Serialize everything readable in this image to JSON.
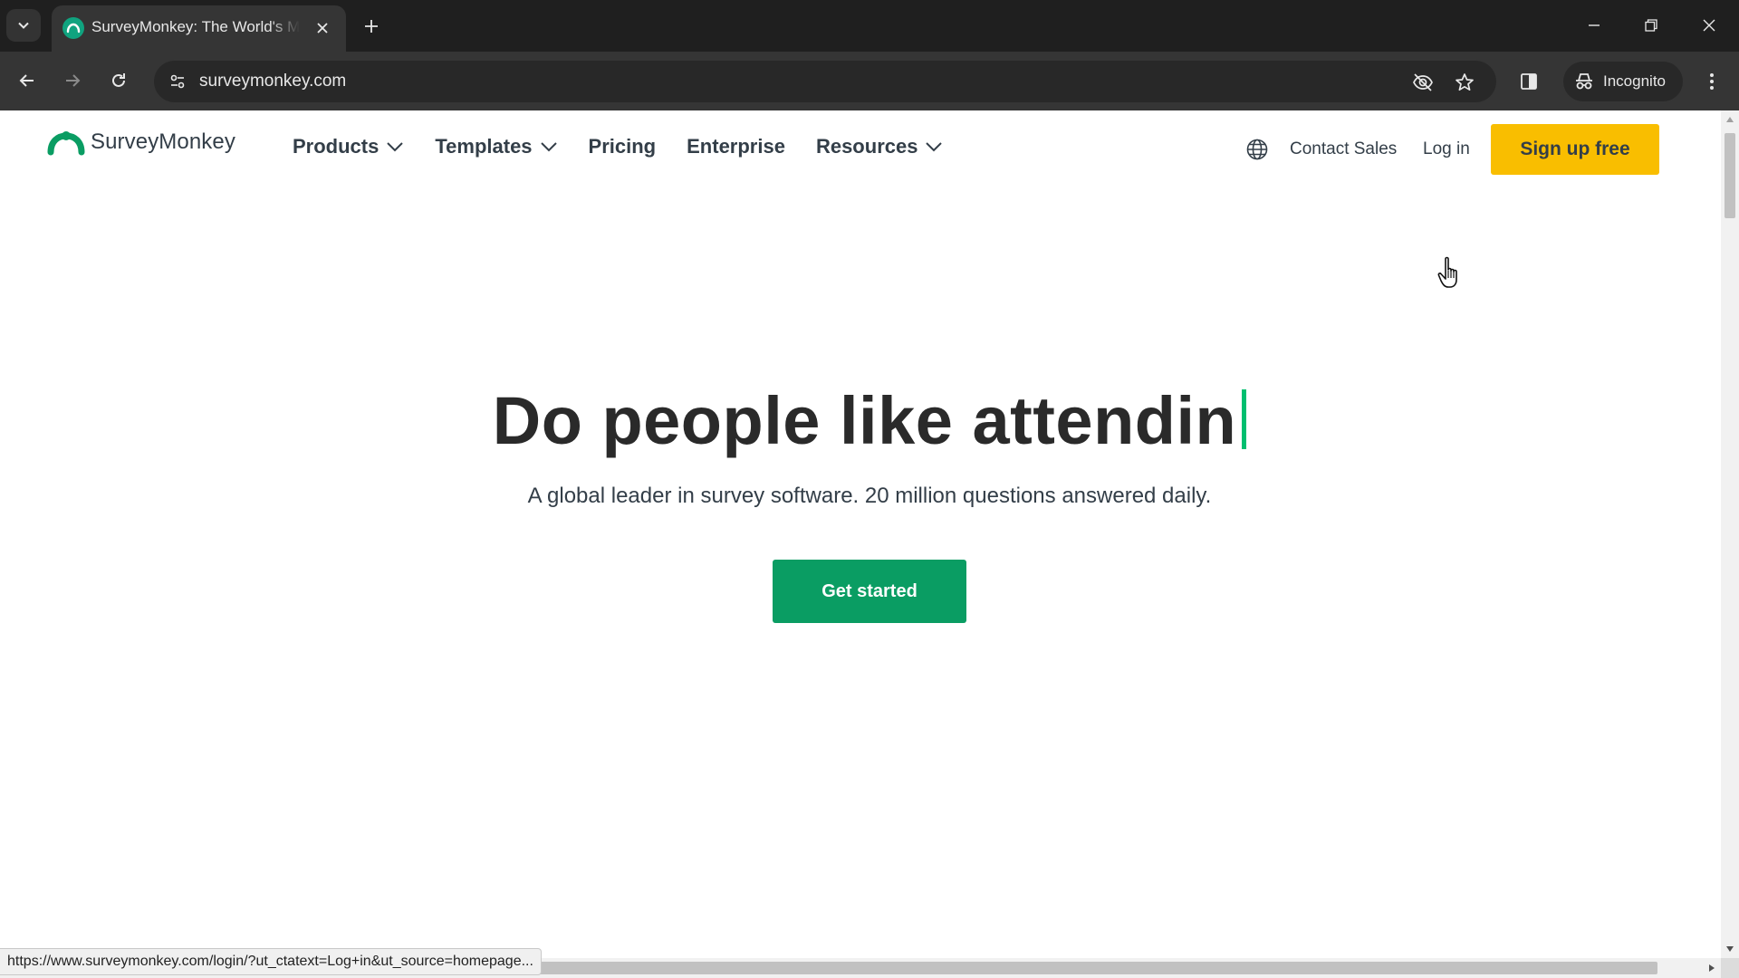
{
  "browser": {
    "tab_title": "SurveyMonkey: The World's Most Popular Free Online Survey Tool",
    "url": "surveymonkey.com",
    "incognito_label": "Incognito",
    "status_url": "https://www.surveymonkey.com/login/?ut_ctatext=Log+in&ut_source=homepage..."
  },
  "header": {
    "logo_text": "SurveyMonkey",
    "nav": [
      {
        "label": "Products",
        "has_dropdown": true
      },
      {
        "label": "Templates",
        "has_dropdown": true
      },
      {
        "label": "Pricing",
        "has_dropdown": false
      },
      {
        "label": "Enterprise",
        "has_dropdown": false
      },
      {
        "label": "Resources",
        "has_dropdown": true
      }
    ],
    "contact_sales": "Contact Sales",
    "login": "Log in",
    "signup": "Sign up free"
  },
  "hero": {
    "headline": "Do people like attendin",
    "subheadline": "A global leader in survey software. 20 million questions answered daily.",
    "cta": "Get started"
  },
  "colors": {
    "brand_green": "#00bf6f",
    "cta_green": "#0a9d63",
    "signup_yellow": "#f9be00",
    "text_dark": "#333e48"
  },
  "icons": {
    "tab_search": "chevron-down-icon",
    "favicon": "surveymonkey-icon",
    "tab_close": "close-icon",
    "new_tab": "plus-icon",
    "back": "arrow-left-icon",
    "forward": "arrow-right-icon",
    "reload": "reload-icon",
    "site_info": "tune-icon",
    "eye_off": "eye-off-icon",
    "bookmark": "star-icon",
    "side_panel": "side-panel-icon",
    "incognito": "incognito-icon",
    "menu": "kebab-menu-icon",
    "language": "globe-icon",
    "cursor": "hand-pointer-icon"
  }
}
